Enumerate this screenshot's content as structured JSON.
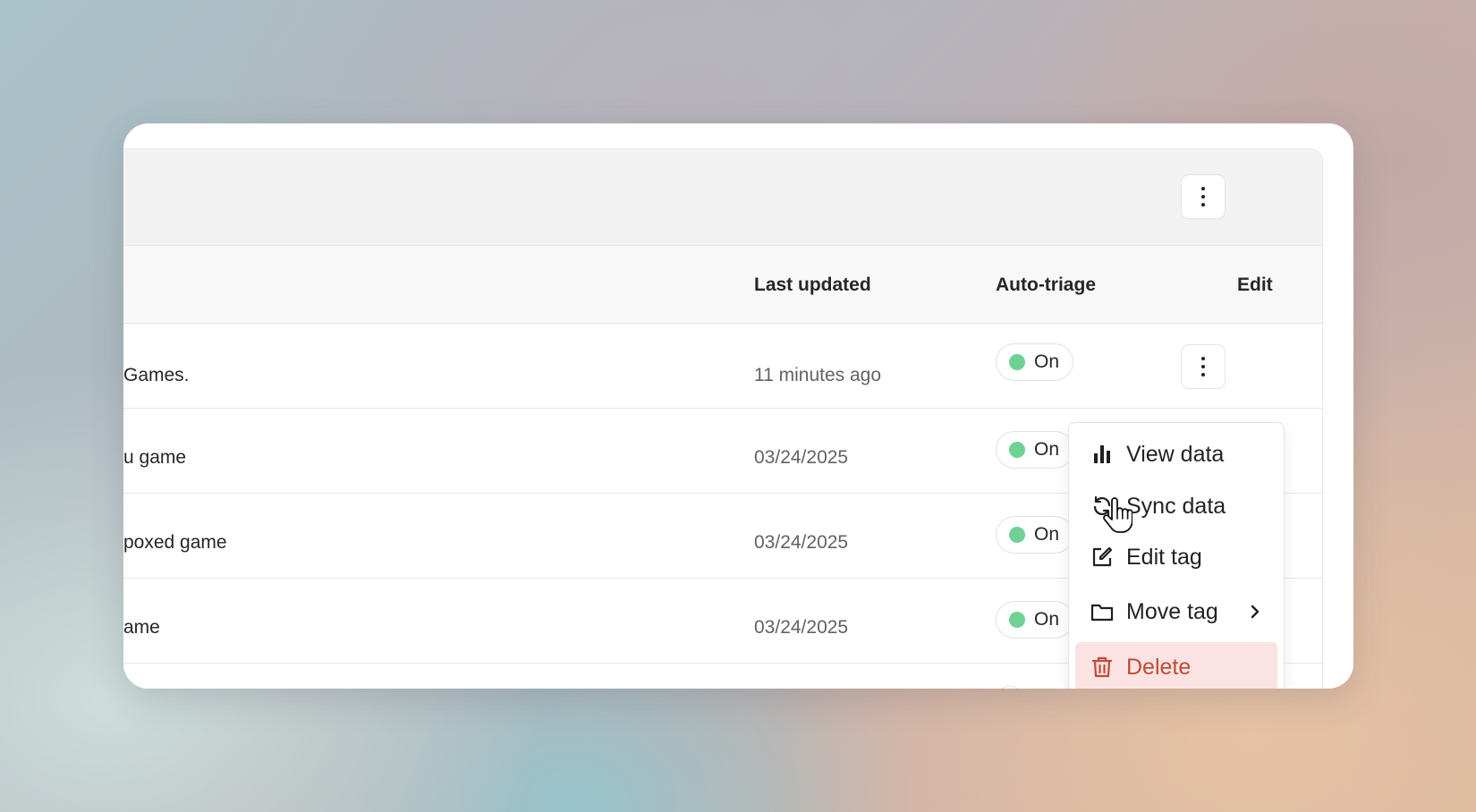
{
  "table": {
    "columns": {
      "last_updated": "Last updated",
      "auto_triage": "Auto-triage",
      "edit": "Edit"
    },
    "rows": [
      {
        "name": "Games.",
        "last_updated": "11 minutes ago",
        "auto_triage": "On"
      },
      {
        "name": "u game",
        "last_updated": "03/24/2025",
        "auto_triage": "On"
      },
      {
        "name": "poxed game",
        "last_updated": "03/24/2025",
        "auto_triage": "On"
      },
      {
        "name": "ame",
        "last_updated": "03/24/2025",
        "auto_triage": "On"
      }
    ]
  },
  "menu": {
    "items": [
      {
        "label": "View data",
        "icon": "bar-chart-icon"
      },
      {
        "label": "Sync data",
        "icon": "refresh-icon"
      },
      {
        "label": "Edit tag",
        "icon": "edit-icon"
      },
      {
        "label": "Move tag",
        "icon": "folder-icon",
        "submenu": true
      },
      {
        "label": "Delete",
        "icon": "trash-icon",
        "highlighted": true
      }
    ]
  },
  "colors": {
    "status_on": "#6fd193",
    "delete_text": "#c34a35",
    "delete_bg": "#fbe3e3"
  }
}
